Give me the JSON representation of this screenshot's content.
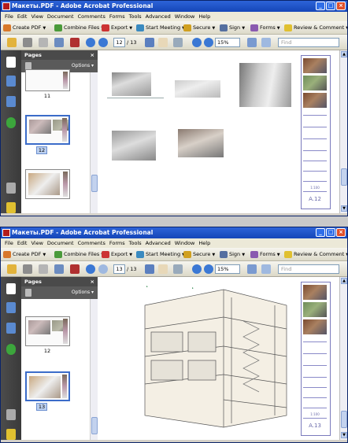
{
  "windows": [
    {
      "title": "Макеты.PDF - Adobe Acrobat Professional",
      "menu": [
        "File",
        "Edit",
        "View",
        "Document",
        "Comments",
        "Forms",
        "Tools",
        "Advanced",
        "Window",
        "Help"
      ],
      "toolbar": {
        "create_pdf": "Create PDF",
        "combine_files": "Combine Files",
        "export": "Export",
        "start_meeting": "Start Meeting",
        "secure": "Secure",
        "sign": "Sign",
        "forms": "Forms",
        "review_comment": "Review & Comment"
      },
      "nav": {
        "page_number": "12",
        "page_total": "/ 13",
        "zoom": "15%",
        "find_placeholder": "Find"
      },
      "pages_panel": {
        "title": "Pages",
        "close": "×",
        "options": "Options",
        "thumb_labels": [
          "11",
          "12"
        ],
        "selected_label": "12"
      },
      "title_block": {
        "sheet": "A.12",
        "scale": "1:100"
      }
    },
    {
      "title": "Макеты.PDF - Adobe Acrobat Professional",
      "menu": [
        "File",
        "Edit",
        "View",
        "Document",
        "Comments",
        "Forms",
        "Tools",
        "Advanced",
        "Window",
        "Help"
      ],
      "toolbar": {
        "create_pdf": "Create PDF",
        "combine_files": "Combine Files",
        "export": "Export",
        "start_meeting": "Start Meeting",
        "secure": "Secure",
        "sign": "Sign",
        "forms": "Forms",
        "review_comment": "Review & Comment"
      },
      "nav": {
        "page_number": "13",
        "page_total": "/ 13",
        "zoom": "15%",
        "find_placeholder": "Find"
      },
      "pages_panel": {
        "title": "Pages",
        "close": "×",
        "options": "Options",
        "thumb_labels": [
          "12",
          "13"
        ],
        "selected_label": "13"
      },
      "title_block": {
        "sheet": "A.13",
        "scale": "1:100"
      }
    }
  ],
  "icons": [
    "pdf-app-icon",
    "pages-icon",
    "attachments-icon",
    "help-icon",
    "signature-icon",
    "print-icon",
    "save-icon",
    "email-icon",
    "prev-page-icon",
    "next-page-icon",
    "hand-tool-icon",
    "select-tool-icon",
    "zoom-in-icon",
    "zoom-out-icon"
  ],
  "colors": {
    "title_bar": "#1546b8",
    "panel_header": "#4a4a4a",
    "selection": "#3b6cc9",
    "sheet_text": "#6a6aaa"
  }
}
